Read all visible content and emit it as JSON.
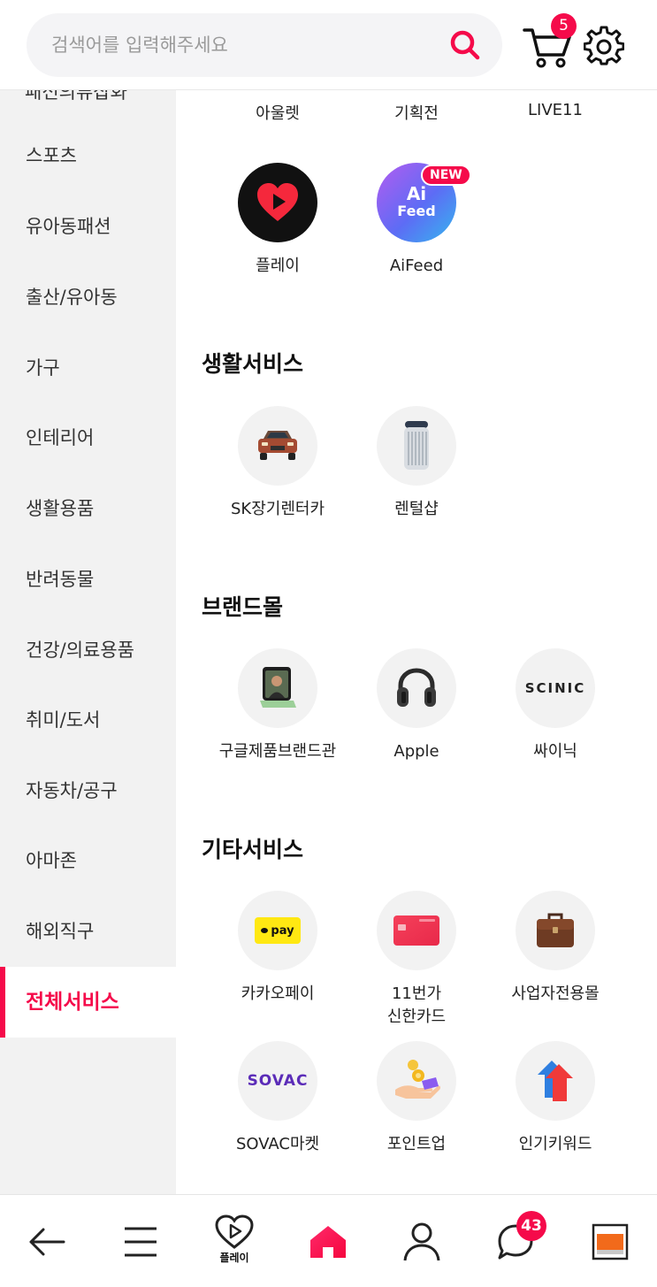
{
  "header": {
    "search_placeholder": "검색어를 입력해주세요",
    "cart_count": "5"
  },
  "sidebar": {
    "cut_item": "패션의류잡화",
    "items": [
      {
        "label": "스포츠"
      },
      {
        "label": "유아동패션"
      },
      {
        "label": "출산/유아동"
      },
      {
        "label": "가구"
      },
      {
        "label": "인테리어"
      },
      {
        "label": "생활용품"
      },
      {
        "label": "반려동물"
      },
      {
        "label": "건강/의료용품"
      },
      {
        "label": "취미/도서"
      },
      {
        "label": "자동차/공구"
      },
      {
        "label": "아마존"
      },
      {
        "label": "해외직구"
      },
      {
        "label": "전체서비스"
      }
    ],
    "active_index": 12
  },
  "main": {
    "top_row": [
      "아울렛",
      "기획전",
      "LIVE11"
    ],
    "top_services": [
      {
        "label": "플레이",
        "icon": "play-heart-icon"
      },
      {
        "label": "AiFeed",
        "icon": "ai-feed-icon",
        "badge": "NEW",
        "icon_line1": "Ai",
        "icon_line2": "Feed"
      }
    ],
    "sections": [
      {
        "title": "생활서비스",
        "items": [
          {
            "label": "SK장기렌터카",
            "icon": "car-icon"
          },
          {
            "label": "렌털샵",
            "icon": "air-purifier-icon"
          }
        ]
      },
      {
        "title": "브랜드몰",
        "items": [
          {
            "label": "구글제품브랜드관",
            "icon": "foldable-phone-icon"
          },
          {
            "label": "Apple",
            "icon": "headphones-icon"
          },
          {
            "label": "싸이닉",
            "icon": "scinic-logo",
            "logo_text": "SCINIC"
          }
        ]
      },
      {
        "title": "기타서비스",
        "items": [
          {
            "label": "카카오페이",
            "icon": "kakaopay-icon",
            "logo_text": "pay"
          },
          {
            "label": "11번가\n신한카드",
            "icon": "credit-card-icon"
          },
          {
            "label": "사업자전용몰",
            "icon": "briefcase-icon"
          },
          {
            "label": "SOVAC마켓",
            "icon": "sovac-logo",
            "logo_text": "SOVAC"
          },
          {
            "label": "포인트업",
            "icon": "coin-hand-icon"
          },
          {
            "label": "인기키워드",
            "icon": "up-arrow-icon"
          }
        ]
      }
    ]
  },
  "bottom_nav": {
    "play_label": "플레이",
    "chat_count": "43"
  },
  "colors": {
    "accent": "#f50a4a",
    "sidebar_bg": "#f2f2f2",
    "icon_bg": "#f2f2f2"
  }
}
